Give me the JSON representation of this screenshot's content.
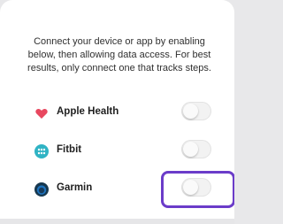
{
  "intro": {
    "text": "Connect your device or app by enabling below, then allowing data access. For best results, only connect one that tracks steps."
  },
  "sources": [
    {
      "label": "Apple Health",
      "icon": "heart-icon",
      "enabled": false,
      "color": "#e8475f"
    },
    {
      "label": "Fitbit",
      "icon": "fitbit-icon",
      "enabled": false,
      "color": "#2fb3c4"
    },
    {
      "label": "Garmin",
      "icon": "garmin-icon",
      "enabled": false,
      "color": "#1e73be"
    }
  ],
  "colors": {
    "focus": "#6b3cc9",
    "partial_icon": "#e85a1b"
  }
}
